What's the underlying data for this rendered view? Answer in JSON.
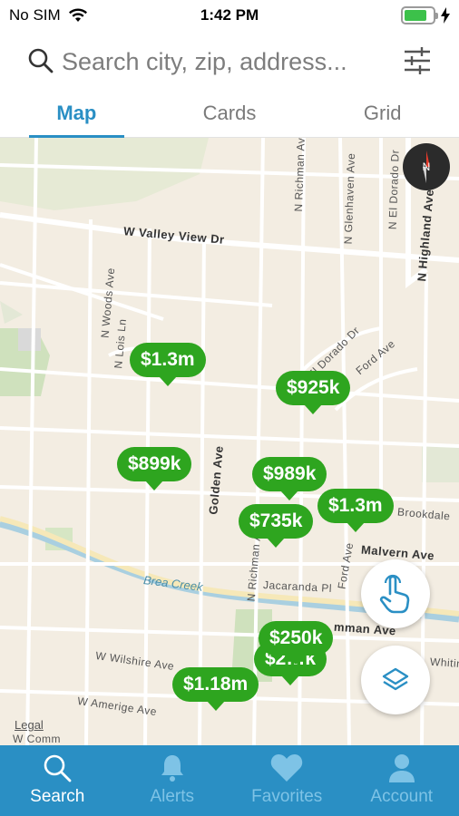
{
  "status_bar": {
    "carrier": "No SIM",
    "time": "1:42 PM",
    "battery_level": 0.8
  },
  "search": {
    "placeholder": "Search city, zip, address..."
  },
  "tabs": [
    {
      "label": "Map",
      "active": true
    },
    {
      "label": "Cards",
      "active": false
    },
    {
      "label": "Grid",
      "active": false
    }
  ],
  "map": {
    "streets": {
      "valley_view": "W Valley View Dr",
      "richman_top": "N Richman Ave",
      "glenhaven": "N Glenhaven Ave",
      "el_dorado": "N El Dorado Dr",
      "highland": "N Highland Ave",
      "woods": "N Woods Ave",
      "lois": "N Lois Ln",
      "dorado_mid": "El Dorado Dr",
      "ford_top": "Ford Ave",
      "golden": "Golden Ave",
      "brookdale": "Brookdale",
      "malvern": "Malvern Ave",
      "richman_low": "N Richman Ave",
      "ford_low": "Ford Ave",
      "jacaranda": "Jacaranda Pl",
      "commonwealth": "mman Ave",
      "whittier": "Whitin",
      "wilshire": "W Wilshire Ave",
      "amerige": "W Amerige Ave",
      "commonwealth_w": "W Comm"
    },
    "creek": "Brea Creek",
    "legal": "Legal",
    "compass_letter": "N",
    "price_pins": [
      {
        "label": "$1.3m"
      },
      {
        "label": "$925k"
      },
      {
        "label": "$899k"
      },
      {
        "label": "$989k"
      },
      {
        "label": "$1.3m"
      },
      {
        "label": "$735k"
      },
      {
        "label": "$2…k"
      },
      {
        "label": "$250k"
      },
      {
        "label": "$1.18m"
      }
    ]
  },
  "bottom_tabs": [
    {
      "label": "Search",
      "icon": "search-icon",
      "active": true
    },
    {
      "label": "Alerts",
      "icon": "bell-icon",
      "active": false
    },
    {
      "label": "Favorites",
      "icon": "heart-icon",
      "active": false
    },
    {
      "label": "Account",
      "icon": "person-icon",
      "active": false
    }
  ],
  "colors": {
    "accent": "#2a8fc4",
    "pin": "#2ea51f",
    "map_bg": "#f3ede2"
  }
}
